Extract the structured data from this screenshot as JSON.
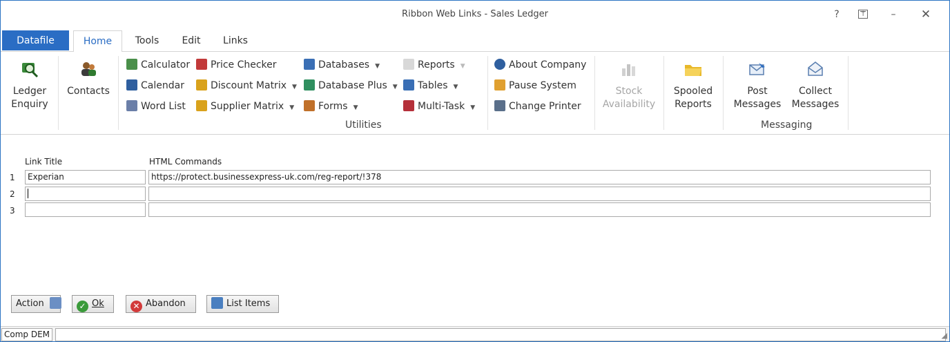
{
  "window": {
    "title": "Ribbon Web Links - Sales Ledger"
  },
  "titlebar_buttons": {
    "help": "?",
    "minimize": "–",
    "close": "✕"
  },
  "tabs": {
    "datafile": "Datafile",
    "home": "Home",
    "tools": "Tools",
    "edit": "Edit",
    "links": "Links"
  },
  "ribbon": {
    "ledger_enquiry": {
      "line1": "Ledger",
      "line2": "Enquiry"
    },
    "contacts": "Contacts",
    "calculator": "Calculator",
    "calendar": "Calendar",
    "word_list": "Word List",
    "price_checker": "Price Checker",
    "discount_matrix": "Discount Matrix",
    "supplier_matrix": "Supplier Matrix",
    "databases": "Databases",
    "database_plus": "Database Plus",
    "forms": "Forms",
    "reports": "Reports",
    "tables": "Tables",
    "multi_task": "Multi-Task",
    "about_company": "About Company",
    "pause_system": "Pause System",
    "change_printer": "Change Printer",
    "stock_availability": {
      "line1": "Stock",
      "line2": "Availability"
    },
    "spooled_reports": {
      "line1": "Spooled",
      "line2": "Reports"
    },
    "post_messages": {
      "line1": "Post",
      "line2": "Messages"
    },
    "collect_messages": {
      "line1": "Collect",
      "line2": "Messages"
    },
    "groups": {
      "utilities": "Utilities",
      "messaging": "Messaging"
    }
  },
  "grid": {
    "columns": {
      "link_title": "Link Title",
      "html_commands": "HTML Commands"
    },
    "rows": [
      {
        "num": "1",
        "title": "Experian",
        "command": "https://protect.businessexpress-uk.com/reg-report/!378"
      },
      {
        "num": "2",
        "title": "",
        "command": ""
      },
      {
        "num": "3",
        "title": "",
        "command": ""
      }
    ]
  },
  "buttons": {
    "action": "Action",
    "ok": "Ok",
    "abandon": "Abandon",
    "list_items": "List Items"
  },
  "statusbar": {
    "company": "Comp DEM"
  },
  "colors": {
    "accent": "#2a6dc4",
    "disabled": "#a6a6a6"
  }
}
